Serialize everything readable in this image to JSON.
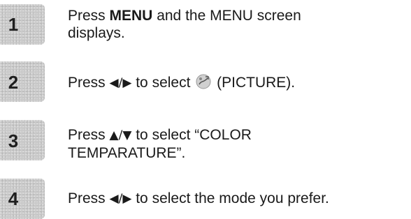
{
  "steps": [
    {
      "number": "1",
      "pre": "Press ",
      "bold": "MENU",
      "post": " and the MENU screen",
      "line2": "displays."
    },
    {
      "number": "2",
      "pre": "Press ",
      "arrows": "◀/▶",
      "mid": " to select ",
      "post": " (PICTURE)."
    },
    {
      "number": "3",
      "pre": "Press ",
      "arrows": "▲/▼",
      "post": " to select “COLOR",
      "line2": "TEMPARATURE”."
    },
    {
      "number": "4",
      "pre": "Press ",
      "arrows": "◀/▶",
      "post": " to select the mode you prefer."
    }
  ],
  "icons": {
    "step2_icon": "picture-icon"
  },
  "colors": {
    "badge": "#c8c8c8",
    "text": "#1a1a1a"
  }
}
